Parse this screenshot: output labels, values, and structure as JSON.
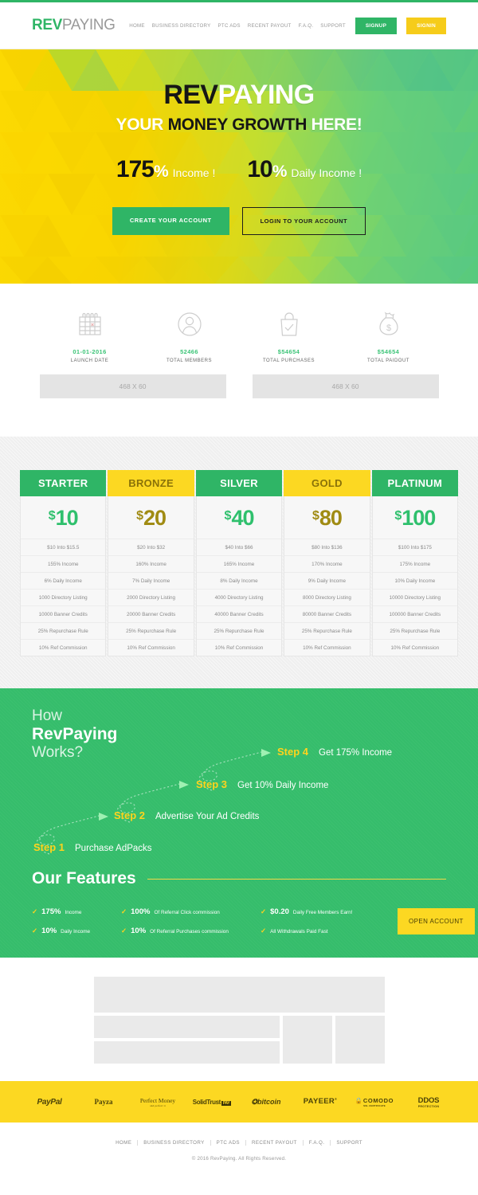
{
  "header": {
    "logo_rev": "REV",
    "logo_paying": "PAYING",
    "nav": [
      {
        "label": "HOME"
      },
      {
        "label": "BUSINESS DIRECTORY"
      },
      {
        "label": "PTC ADS"
      },
      {
        "label": "RECENT PAYOUT"
      },
      {
        "label": "F.A.Q."
      },
      {
        "label": "SUPPORT"
      }
    ],
    "signup": "SIGNUP",
    "signin": "SIGNIN"
  },
  "hero": {
    "title_dark": "REV",
    "title_light": "PAYING",
    "sub_a": "YOUR ",
    "sub_b": "MONEY GROWTH",
    "sub_c": " HERE!",
    "rate1_num": "175",
    "rate1_pct": "%",
    "rate1_label": "Income !",
    "rate2_num": "10",
    "rate2_pct": "%",
    "rate2_label": "Daily Income !",
    "btn_primary": "CREATE YOUR ACCOUNT",
    "btn_outline": "LOGIN TO YOUR ACCOUNT"
  },
  "stats": [
    {
      "icon": "calendar-icon",
      "value": "01-01-2016",
      "label": "LAUNCH DATE"
    },
    {
      "icon": "user-icon",
      "value": "52466",
      "label": "TOTAL MEMBERS"
    },
    {
      "icon": "shopping-bag-icon",
      "value": "$54654",
      "label": "TOTAL PURCHASES"
    },
    {
      "icon": "money-bag-icon",
      "value": "$54654",
      "label": "TOTAL PAIDOUT"
    }
  ],
  "ads": [
    {
      "label": "468 X 60"
    },
    {
      "label": "468 X 60"
    }
  ],
  "pricing": {
    "plans": [
      {
        "name": "STARTER",
        "theme": "green",
        "currency": "$",
        "amount": "10",
        "features": [
          "$10 Into $15.5",
          "155% Income",
          "6% Daily Income",
          "1000 Directory Listing",
          "10000 Banner Credits",
          "25% Repurchase Rule",
          "10% Ref Commission"
        ]
      },
      {
        "name": "BRONZE",
        "theme": "yellow",
        "currency": "$",
        "amount": "20",
        "features": [
          "$20 Into $32",
          "160% Income",
          "7% Daily Income",
          "2000 Directory Listing",
          "20000 Banner Credits",
          "25% Repurchase Rule",
          "10% Ref Commission"
        ]
      },
      {
        "name": "SILVER",
        "theme": "green",
        "currency": "$",
        "amount": "40",
        "features": [
          "$40 Into $66",
          "165% Income",
          "8% Daily Income",
          "4000 Directory Listing",
          "40000 Banner Credits",
          "25% Repurchase Rule",
          "10% Ref Commission"
        ]
      },
      {
        "name": "GOLD",
        "theme": "yellow",
        "currency": "$",
        "amount": "80",
        "features": [
          "$80 Into $136",
          "170% Income",
          "9% Daily Income",
          "8000 Directory Listing",
          "80000 Banner Credits",
          "25% Repurchase Rule",
          "10% Ref Commission"
        ]
      },
      {
        "name": "PLATINUM",
        "theme": "green",
        "currency": "$",
        "amount": "100",
        "features": [
          "$100 Into $175",
          "175% Income",
          "10% Daily Income",
          "10000 Directory Listing",
          "100000 Banner Credits",
          "25% Repurchase Rule",
          "10% Ref Commission"
        ]
      }
    ]
  },
  "how": {
    "line1": "How",
    "line2": "RevPaying",
    "line3": "Works?",
    "steps": [
      {
        "n": "Step 1",
        "text": "Purchase AdPacks"
      },
      {
        "n": "Step 2",
        "text": "Advertise Your Ad Credits"
      },
      {
        "n": "Step 3",
        "text": "Get 10% Daily Income"
      },
      {
        "n": "Step 4",
        "text": "Get 175% Income"
      }
    ]
  },
  "features": {
    "title": "Our Features",
    "col1": [
      {
        "strong": "175%",
        "text": "Income"
      },
      {
        "strong": "10%",
        "text": "Daily Income"
      }
    ],
    "col2": [
      {
        "strong": "100%",
        "text": "Of Referral Click commission"
      },
      {
        "strong": "10%",
        "text": "Of Referral Purchases commission"
      }
    ],
    "col3": [
      {
        "strong": "$0.20",
        "text": "Daily Free Members Earn!"
      },
      {
        "strong": "",
        "text": "All Withdrawals Paid Fast"
      }
    ],
    "cta": "OPEN ACCOUNT"
  },
  "payments": [
    {
      "name": "PayPal",
      "style": "p1"
    },
    {
      "name": "Payza",
      "style": "p2"
    },
    {
      "name": "Perfect Money",
      "sub": "and perfect it",
      "style": "p3"
    },
    {
      "name": "SolidTrust",
      "badge": "PAY",
      "style": "p4"
    },
    {
      "name": "bitcoin",
      "style": "p5"
    },
    {
      "name": "PAYEER",
      "style": "p6"
    },
    {
      "name": "COMODO",
      "sub": "SSL CERTIFICATE",
      "style": "p7"
    },
    {
      "name": "DDOS",
      "sub": "PROTECTION",
      "style": "p8"
    }
  ],
  "footer": {
    "nav": [
      {
        "label": "HOME"
      },
      {
        "label": "BUSINESS DIRECTORY"
      },
      {
        "label": "PTC ADS"
      },
      {
        "label": "RECENT PAYOUT"
      },
      {
        "label": "F.A.Q."
      },
      {
        "label": "SUPPORT"
      }
    ],
    "copyright": "© 2016 RevPaying. All Rights Reserved."
  },
  "colors": {
    "green": "#2fb566",
    "yellow": "#fcd822",
    "how_bg": "#35bd6b",
    "gold_text": "#a08b13"
  }
}
